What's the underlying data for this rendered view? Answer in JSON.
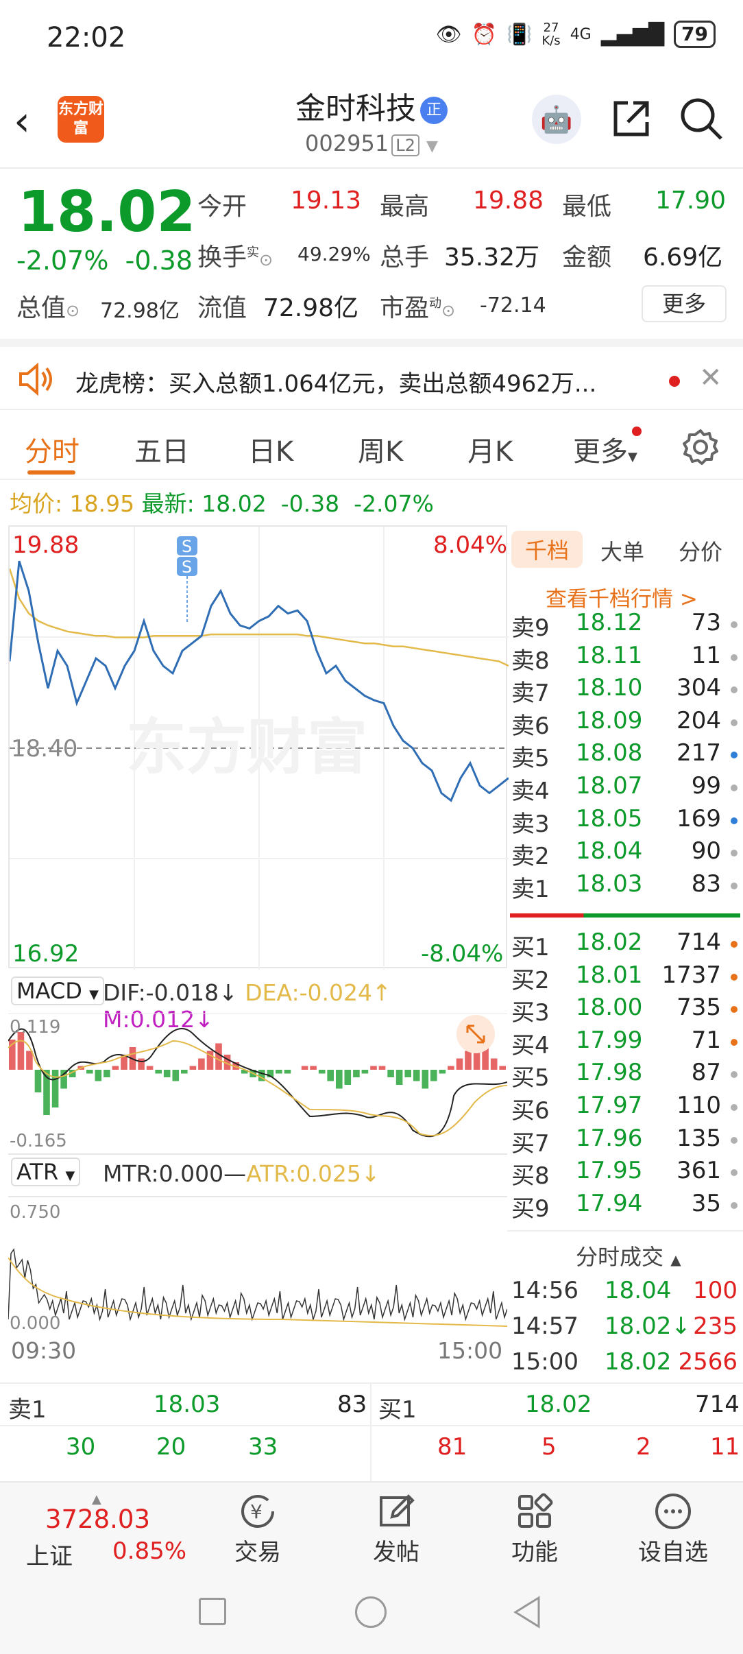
{
  "status_bar": {
    "time": "22:02",
    "net_speed_value": "27",
    "net_speed_unit": "K/s",
    "network": "4G",
    "battery": "79"
  },
  "header": {
    "logo_text": "东方财富",
    "title": "金时科技",
    "badge": "正",
    "code": "002951",
    "level": "L2"
  },
  "quote": {
    "price": "18.02",
    "change_pct": "-2.07%",
    "change": "-0.38",
    "open_label": "今开",
    "open": "19.13",
    "high_label": "最高",
    "high": "19.88",
    "low_label": "最低",
    "low": "17.90",
    "turnover_label": "换手",
    "turnover_sup": "实",
    "turnover": "49.29%",
    "volume_label": "总手",
    "volume": "35.32万",
    "amount_label": "金额",
    "amount": "6.69亿",
    "mcap_label": "总值",
    "mcap": "72.98亿",
    "float_label": "流值",
    "float": "72.98亿",
    "pe_label": "市盈",
    "pe_sup": "动",
    "pe": "-72.14",
    "more_label": "更多"
  },
  "notice": {
    "text": "龙虎榜：买入总额1.064亿元，卖出总额4962万..."
  },
  "tabs": [
    "分时",
    "五日",
    "日K",
    "周K",
    "月K",
    "更多"
  ],
  "info_line": {
    "avg_label": "均价:",
    "avg": "18.95",
    "latest_label": "最新:",
    "latest": "18.02",
    "change": "-0.38",
    "pct": "-2.07%"
  },
  "chart_data": {
    "type": "line",
    "title": "",
    "x_start": "09:30",
    "x_end": "15:00",
    "ylim": [
      16.92,
      19.88
    ],
    "prev_close": 18.4,
    "top_left": "19.88",
    "top_right": "8.04%",
    "mid_label": "18.40",
    "bottom_left": "16.92",
    "bottom_right": "-8.04%",
    "watermark": "东方财富",
    "marker": "S",
    "series": [
      {
        "values": [
          18.98,
          19.65,
          19.45,
          19.1,
          18.8,
          19.05,
          18.95,
          18.7,
          18.85,
          19.0,
          18.95,
          18.8,
          18.95,
          19.05,
          19.25,
          19.05,
          18.95,
          18.9,
          19.05,
          19.1,
          19.15,
          19.35,
          19.45,
          19.3,
          19.22,
          19.2,
          19.25,
          19.28,
          19.35,
          19.3,
          19.32,
          19.25,
          19.05,
          18.9,
          18.95,
          18.85,
          18.8,
          18.75,
          18.72,
          18.7,
          18.55,
          18.45,
          18.4,
          18.3,
          18.25,
          18.1,
          18.05,
          18.2,
          18.3,
          18.15,
          18.1,
          18.15,
          18.2
        ]
      },
      {
        "values": [
          19.6,
          19.4,
          19.3,
          19.25,
          19.22,
          19.2,
          19.18,
          19.17,
          19.16,
          19.15,
          19.15,
          19.14,
          19.14,
          19.14,
          19.14,
          19.15,
          19.15,
          19.15,
          19.15,
          19.15,
          19.15,
          19.16,
          19.16,
          19.16,
          19.16,
          19.16,
          19.16,
          19.16,
          19.16,
          19.16,
          19.16,
          19.15,
          19.15,
          19.14,
          19.13,
          19.12,
          19.11,
          19.1,
          19.1,
          19.09,
          19.08,
          19.08,
          19.07,
          19.06,
          19.05,
          19.04,
          19.03,
          19.02,
          19.01,
          19.0,
          18.99,
          18.98,
          18.95
        ]
      }
    ]
  },
  "macd": {
    "selector": "MACD",
    "dif": "DIF:-0.018",
    "dea": "DEA:-0.024",
    "m": "M:0.012",
    "max_label": "0.119",
    "min_label": "-0.165",
    "hist": [
      0.08,
      0.1,
      0.05,
      -0.06,
      -0.12,
      -0.1,
      -0.05,
      -0.02,
      0.01,
      -0.01,
      -0.03,
      -0.02,
      0.01,
      0.04,
      0.06,
      0.03,
      0.01,
      -0.01,
      -0.02,
      -0.03,
      -0.01,
      0.01,
      0.03,
      0.05,
      0.07,
      0.04,
      0.02,
      -0.01,
      -0.02,
      -0.03,
      -0.02,
      -0.01,
      -0.01,
      0.0,
      0.01,
      0.01,
      -0.01,
      -0.03,
      -0.05,
      -0.04,
      -0.02,
      -0.01,
      0.01,
      0.01,
      -0.02,
      -0.04,
      -0.02,
      -0.03,
      -0.05,
      -0.03,
      -0.01,
      0.01,
      0.03,
      0.05,
      0.08,
      0.06,
      0.03,
      0.01
    ]
  },
  "atr": {
    "selector": "ATR",
    "mtr": "MTR:0.000",
    "atr": "ATR:0.025",
    "max_label": "0.750",
    "min_label": "0.000",
    "time_start": "09:30",
    "time_end": "15:00"
  },
  "orderbook": {
    "tabs": [
      "千档",
      "大单",
      "分价"
    ],
    "link": "查看千档行情 >",
    "asks": [
      {
        "label": "卖9",
        "price": "18.12",
        "vol": "73",
        "dot": "#b0b0b0"
      },
      {
        "label": "卖8",
        "price": "18.11",
        "vol": "11",
        "dot": "#b0b0b0"
      },
      {
        "label": "卖7",
        "price": "18.10",
        "vol": "304",
        "dot": "#b0b0b0"
      },
      {
        "label": "卖6",
        "price": "18.09",
        "vol": "204",
        "dot": "#b0b0b0"
      },
      {
        "label": "卖5",
        "price": "18.08",
        "vol": "217",
        "dot": "#2f7fd8"
      },
      {
        "label": "卖4",
        "price": "18.07",
        "vol": "99",
        "dot": "#b0b0b0"
      },
      {
        "label": "卖3",
        "price": "18.05",
        "vol": "169",
        "dot": "#2f7fd8"
      },
      {
        "label": "卖2",
        "price": "18.04",
        "vol": "90",
        "dot": "#b0b0b0"
      },
      {
        "label": "卖1",
        "price": "18.03",
        "vol": "83",
        "dot": "#b0b0b0"
      }
    ],
    "bids": [
      {
        "label": "买1",
        "price": "18.02",
        "vol": "714",
        "dot": "#e8721a"
      },
      {
        "label": "买2",
        "price": "18.01",
        "vol": "1737",
        "dot": "#e8721a"
      },
      {
        "label": "买3",
        "price": "18.00",
        "vol": "735",
        "dot": "#e8721a"
      },
      {
        "label": "买4",
        "price": "17.99",
        "vol": "71",
        "dot": "#e8721a"
      },
      {
        "label": "买5",
        "price": "17.98",
        "vol": "87",
        "dot": "#b0b0b0"
      },
      {
        "label": "买6",
        "price": "17.97",
        "vol": "110",
        "dot": "#b0b0b0"
      },
      {
        "label": "买7",
        "price": "17.96",
        "vol": "135",
        "dot": "#b0b0b0"
      },
      {
        "label": "买8",
        "price": "17.95",
        "vol": "361",
        "dot": "#b0b0b0"
      },
      {
        "label": "买9",
        "price": "17.94",
        "vol": "35",
        "dot": "#b0b0b0"
      }
    ],
    "trades_header": "分时成交",
    "trades": [
      {
        "time": "14:56",
        "price": "18.04",
        "vol": "100"
      },
      {
        "time": "14:57",
        "price": "18.02↓",
        "vol": "235"
      },
      {
        "time": "15:00",
        "price": "18.02",
        "vol": "2566"
      }
    ]
  },
  "bottom_book": {
    "ask_label": "卖1",
    "ask_price": "18.03",
    "ask_vol": "83",
    "bid_label": "买1",
    "bid_price": "18.02",
    "bid_vol": "714",
    "ask_queue": [
      "30",
      "20",
      "33"
    ],
    "bid_queue": [
      "81",
      "5",
      "2",
      "11"
    ]
  },
  "bottom_nav": {
    "index_value": "3728.03",
    "index_name": "上证",
    "index_pct": "0.85%",
    "items": [
      "交易",
      "发帖",
      "功能",
      "设自选"
    ]
  },
  "colors": {
    "up": "#e02020",
    "down": "#0c9a2a",
    "accent": "#e8721a",
    "price_line": "#2f6db5",
    "avg_line": "#e3b94a"
  }
}
